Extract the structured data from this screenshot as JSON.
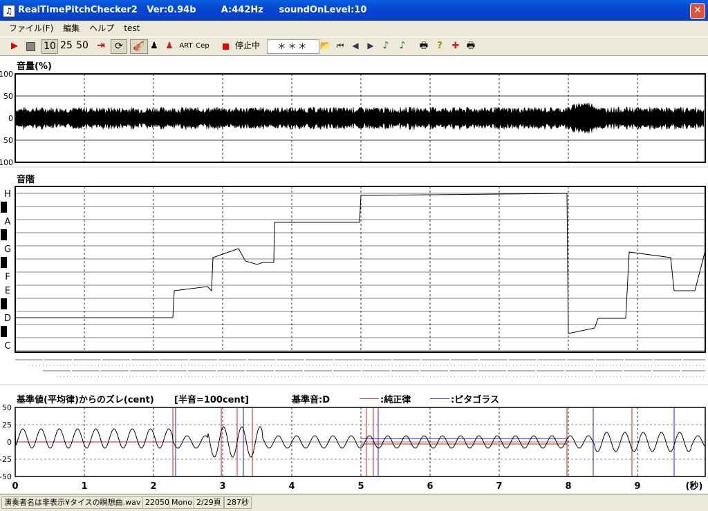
{
  "window": {
    "title": "RealTimePitchChecker2   Ver:0.94b        A:442Hz     soundOnLevel:10"
  },
  "menu": [
    "ファイル(F)",
    "編集",
    "ヘルプ",
    "test"
  ],
  "toolbar": {
    "counts": [
      "10",
      "25",
      "50"
    ],
    "art_label": "ART",
    "cep_label": "Cep",
    "status_label": "停止中",
    "note_display": "＊＊＊"
  },
  "volume_panel": {
    "title": "音量(%)",
    "y_labels": [
      "100",
      "50",
      "0",
      "50",
      "100"
    ]
  },
  "scale_panel": {
    "title": "音階",
    "notes": [
      "H",
      "A",
      "G",
      "F",
      "E",
      "D",
      "C"
    ]
  },
  "cent_panel": {
    "title": "基準値(平均律)からのズレ(cent)",
    "subtitle": "[半音=100cent]",
    "reference": "基準音:D",
    "legend": [
      {
        "label": ":純正律",
        "color": "#c81e1e"
      },
      {
        "label": ":ピタゴラス",
        "color": "#1e1ec8"
      }
    ],
    "y_labels": [
      "50",
      "25",
      "0",
      "-25",
      "-50"
    ]
  },
  "time_axis": {
    "ticks": [
      "0",
      "1",
      "2",
      "3",
      "4",
      "5",
      "6",
      "7",
      "8",
      "9"
    ],
    "unit": "(秒)"
  },
  "statusbar": {
    "file": "演奏者名は非表示¥タイスの瞑想曲.wav",
    "rate": "22050",
    "channels": "Mono",
    "page": "2/29頁",
    "length": "287秒"
  },
  "colors": {
    "titlebar": "#0a4fd6",
    "chrome": "#ece9d8",
    "pure_temperament": "#c81e1e",
    "pythagorean": "#1e1ec8"
  }
}
